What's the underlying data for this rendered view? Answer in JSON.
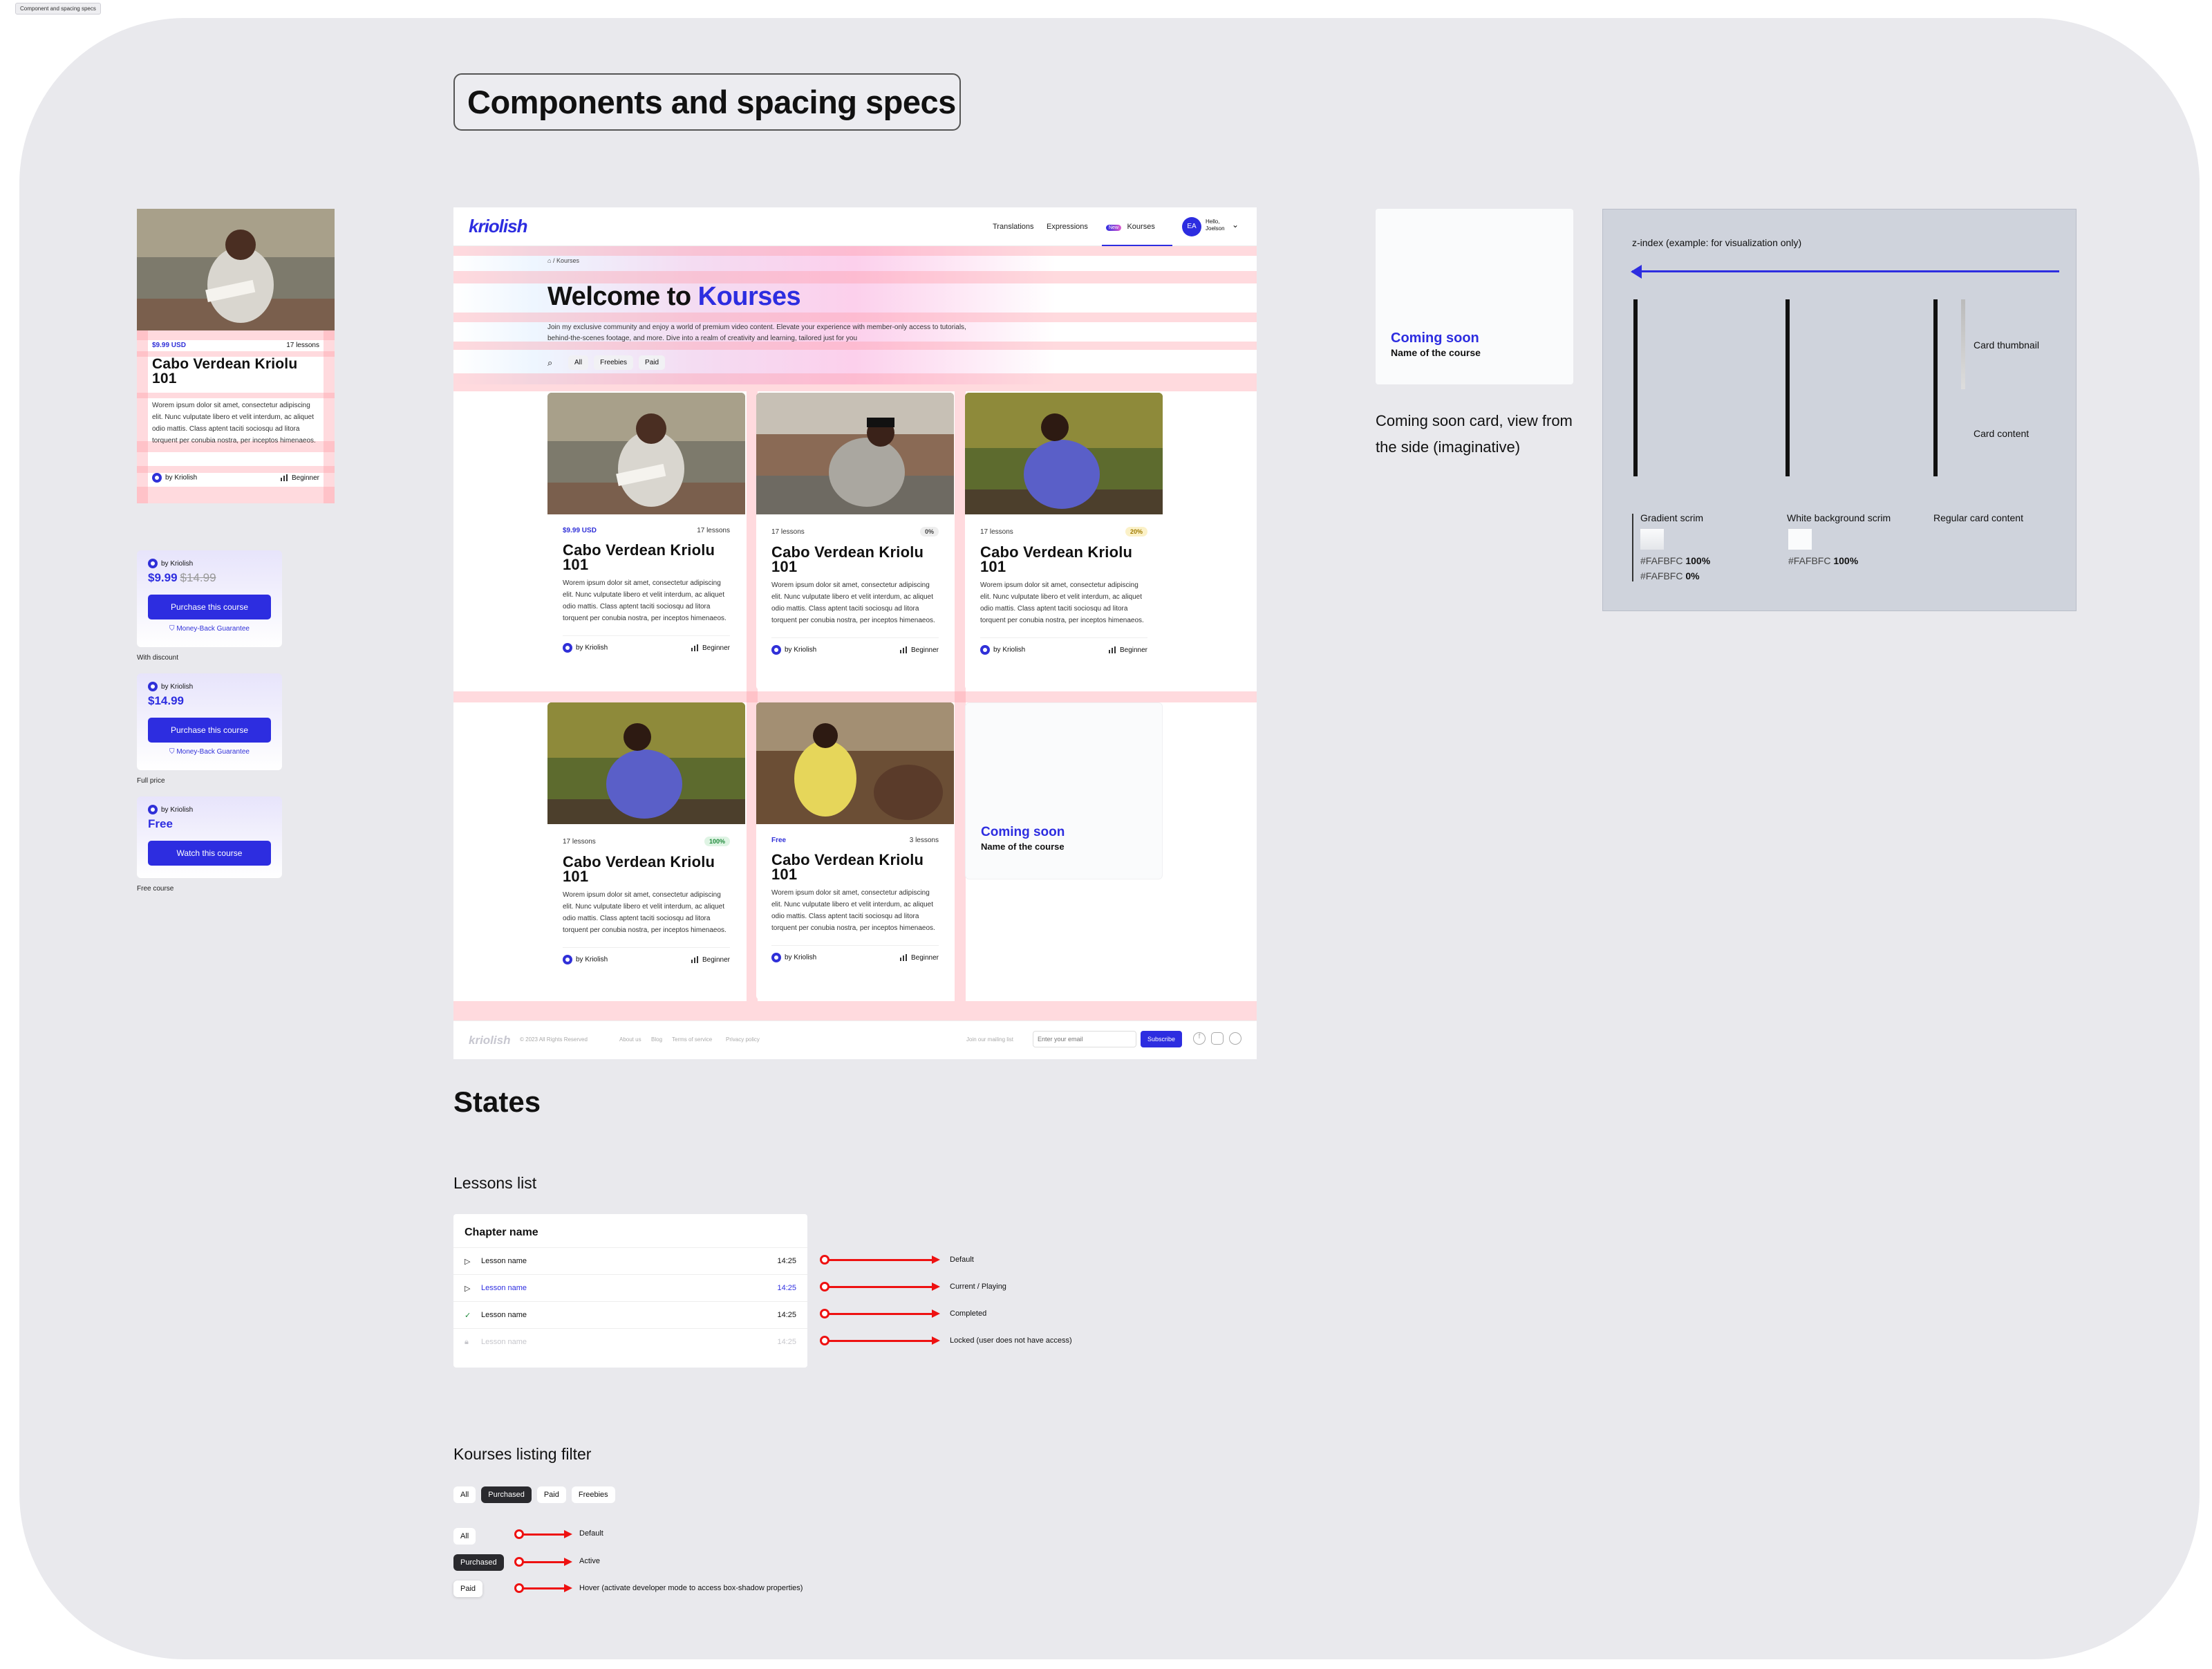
{
  "frame_tag": "Component and spacing specs",
  "page_title": "Components and spacing specs",
  "spec_card": {
    "price": "$9.99 USD",
    "lessons": "17 lessons",
    "title": "Cabo Verdean Kriolu 101",
    "desc": "Worem ipsum dolor sit amet, consectetur adipiscing elit. Nunc vulputate libero et velit interdum, ac aliquet odio mattis. Class aptent taciti sociosqu ad litora torquent per conubia nostra, per inceptos himenaeos.",
    "author": "by Kriolish",
    "level": "Beginner",
    "spacing_marks": [
      "16",
      "16",
      "8",
      "16",
      "8",
      "16",
      "24",
      "16"
    ]
  },
  "purchase_panels": [
    {
      "by": "by Kriolish",
      "price": "$9.99",
      "old_price": "$14.99",
      "button": "Purchase this course",
      "guarantee": "Money-Back Guarantee",
      "label": "With discount"
    },
    {
      "by": "by Kriolish",
      "price": "$14.99",
      "old_price": "",
      "button": "Purchase this course",
      "guarantee": "Money-Back Guarantee",
      "label": "Full price"
    },
    {
      "by": "by Kriolish",
      "price": "Free",
      "old_price": "",
      "button": "Watch this course",
      "guarantee": "",
      "label": "Free course"
    }
  ],
  "site": {
    "logo": "kriolish",
    "nav": {
      "translations": "Translations",
      "expressions": "Expressions",
      "new_badge": "New",
      "kourses": "Kourses",
      "avatar": "EA",
      "hello": "Hello,",
      "user": "Joelson"
    },
    "breadcrumb": {
      "sep": "/",
      "current": "Kourses"
    },
    "hero": {
      "title_a": "Welcome to",
      "title_b": "Kourses",
      "subtitle": "Join my exclusive community and enjoy a world of premium video content. Elevate your experience with member-only access to tutorials, behind-the-scenes footage, and more. Dive into a realm of creativity and learning, tailored just for you"
    },
    "filters": [
      "All",
      "Freebies",
      "Paid"
    ],
    "spacing_marks": {
      "hero_top": "16",
      "title": "16",
      "hero_bottom": "24",
      "filters": "16",
      "grid": "40",
      "row_gap": "24",
      "footer": "40"
    },
    "cards": [
      {
        "left": "$9.99 USD",
        "right": "17 lessons",
        "badge": "",
        "title": "Cabo Verdean Kriolu 101",
        "desc": "Worem ipsum dolor sit amet, consectetur adipiscing elit. Nunc vulputate libero et velit interdum, ac aliquet odio mattis. Class aptent taciti sociosqu ad litora torquent per conubia nostra, per inceptos himenaeos.",
        "author": "by Kriolish",
        "level": "Beginner"
      },
      {
        "left": "17 lessons",
        "right": "",
        "badge": "0%",
        "title": "Cabo Verdean Kriolu 101",
        "desc": "Worem ipsum dolor sit amet, consectetur adipiscing elit. Nunc vulputate libero et velit interdum, ac aliquet odio mattis. Class aptent taciti sociosqu ad litora torquent per conubia nostra, per inceptos himenaeos.",
        "author": "by Kriolish",
        "level": "Beginner"
      },
      {
        "left": "17 lessons",
        "right": "",
        "badge": "20%",
        "title": "Cabo Verdean Kriolu 101",
        "desc": "Worem ipsum dolor sit amet, consectetur adipiscing elit. Nunc vulputate libero et velit interdum, ac aliquet odio mattis. Class aptent taciti sociosqu ad litora torquent per conubia nostra, per inceptos himenaeos.",
        "author": "by Kriolish",
        "level": "Beginner"
      },
      {
        "left": "17 lessons",
        "right": "",
        "badge": "100%",
        "title": "Cabo Verdean Kriolu 101",
        "desc": "Worem ipsum dolor sit amet, consectetur adipiscing elit. Nunc vulputate libero et velit interdum, ac aliquet odio mattis. Class aptent taciti sociosqu ad litora torquent per conubia nostra, per inceptos himenaeos.",
        "author": "by Kriolish",
        "level": "Beginner"
      },
      {
        "left": "Free",
        "right": "3 lessons",
        "badge": "",
        "title": "Cabo Verdean Kriolu 101",
        "desc": "Worem ipsum dolor sit amet, consectetur adipiscing elit. Nunc vulputate libero et velit interdum, ac aliquet odio mattis. Class aptent taciti sociosqu ad litora torquent per conubia nostra, per inceptos himenaeos.",
        "author": "by Kriolish",
        "level": "Beginner"
      }
    ],
    "coming_soon": {
      "title": "Coming soon",
      "sub": "Name of the course"
    },
    "footer": {
      "logo": "kriolish",
      "copyright": "© 2023 All Rights Reserved",
      "links": [
        "About us",
        "Blog",
        "Terms of service",
        "Privacy policy"
      ],
      "mailing": "Join our mailing list",
      "placeholder": "Enter your email",
      "subscribe": "Subscribe"
    }
  },
  "coming_soon_card": {
    "title": "Coming soon",
    "sub": "Name of the course",
    "caption": "Coming soon card, view from the side (imaginative)"
  },
  "zindex": {
    "title": "z-index (example: for visualization only)",
    "thumb": "Card thumbnail",
    "content": "Card content",
    "layers": [
      {
        "name": "Gradient scrim",
        "c1": "#FAFBFC",
        "p1": "100%",
        "c2": "#FAFBFC",
        "p2": "0%"
      },
      {
        "name": "White background scrim",
        "c1": "#FAFBFC",
        "p1": "100%"
      },
      {
        "name": "Regular card content"
      }
    ]
  },
  "states": {
    "title": "States",
    "lessons_title": "Lessons list",
    "chapter": "Chapter name",
    "lessons": [
      {
        "name": "Lesson name",
        "time": "14:25",
        "state": "Default"
      },
      {
        "name": "Lesson name",
        "time": "14:25",
        "state": "Current / Playing"
      },
      {
        "name": "Lesson name",
        "time": "14:25",
        "state": "Completed"
      },
      {
        "name": "Lesson name",
        "time": "14:25",
        "state": "Locked (user does not have access)"
      }
    ],
    "filter_title": "Kourses listing filter",
    "filters": [
      "All",
      "Purchased",
      "Paid",
      "Freebies"
    ],
    "filter_states": [
      {
        "chip": "All",
        "label": "Default"
      },
      {
        "chip": "Purchased",
        "label": "Active"
      },
      {
        "chip": "Paid",
        "label": "Hover (activate developer mode to access box-shadow properties)"
      }
    ]
  }
}
